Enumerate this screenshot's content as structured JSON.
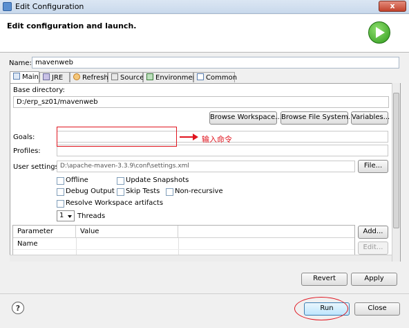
{
  "window": {
    "title": "Edit Configuration",
    "close_glyph": "x"
  },
  "header": {
    "title": "Edit configuration and launch.",
    "icon": "run-icon"
  },
  "name": {
    "label": "Name:",
    "value": "mavenweb"
  },
  "tabs": [
    {
      "label": "Main",
      "icon": "main-tab-icon",
      "active": true
    },
    {
      "label": "JRE",
      "icon": "jre-icon"
    },
    {
      "label": "Refresh",
      "icon": "refresh-icon"
    },
    {
      "label": "Source",
      "icon": "source-icon"
    },
    {
      "label": "Environment",
      "icon": "environment-icon"
    },
    {
      "label": "Common",
      "icon": "common-icon"
    }
  ],
  "main": {
    "base_dir_label": "Base directory:",
    "base_dir_value": "D:/erp_sz01/mavenweb",
    "browse_workspace": "Browse Workspace...",
    "browse_filesystem": "Browse File System...",
    "variables": "Variables...",
    "goals_label": "Goals:",
    "goals_value": "",
    "goals_annotation": "输入命令",
    "profiles_label": "Profiles:",
    "profiles_value": "",
    "user_settings_label": "User settings:",
    "user_settings_value": "D:\\apache-maven-3.3.9\\conf\\settings.xml",
    "file_button": "File...",
    "checks": {
      "offline": "Offline",
      "update_snapshots": "Update Snapshots",
      "debug_output": "Debug Output",
      "skip_tests": "Skip Tests",
      "non_recursive": "Non-recursive",
      "resolve_workspace": "Resolve Workspace artifacts"
    },
    "threads_value": "1",
    "threads_label": "Threads",
    "table": {
      "col_name": "Parameter Name",
      "col_value": "Value"
    },
    "add_button": "Add...",
    "edit_button": "Edit..."
  },
  "buttons": {
    "revert": "Revert",
    "apply": "Apply",
    "run": "Run",
    "close": "Close",
    "help": "?"
  },
  "colors": {
    "annotation": "#e0141e",
    "run_icon": "#2f9a1c"
  }
}
